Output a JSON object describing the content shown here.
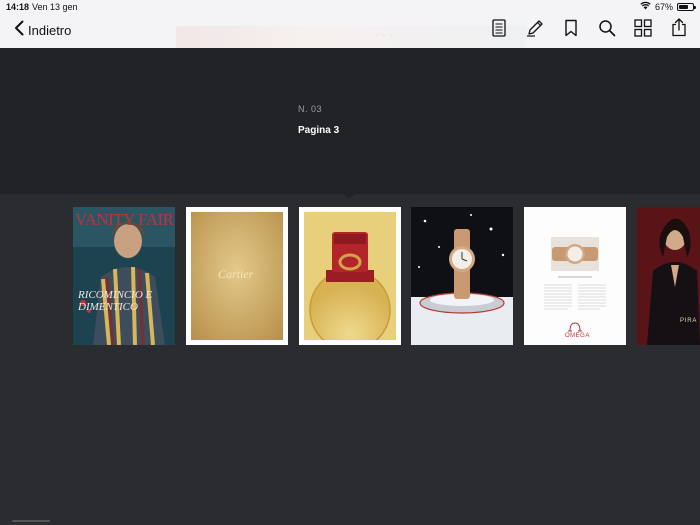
{
  "status": {
    "time": "14:18",
    "date": "Ven 13 gen",
    "battery_percent": "67%",
    "battery_level": 0.67
  },
  "nav": {
    "back_label": "Indietro",
    "tools": [
      {
        "icon": "contents-icon"
      },
      {
        "icon": "pencil-icon"
      },
      {
        "icon": "bookmark-icon"
      },
      {
        "icon": "search-icon"
      },
      {
        "icon": "thumbnails-icon"
      },
      {
        "icon": "share-icon"
      }
    ]
  },
  "info": {
    "issue": "N. 03",
    "page": "Pagina 3"
  },
  "thumbs": [
    {
      "cover_title": "VANITY FAIR",
      "headline": "RICOMINCIO E DIMENTICO"
    },
    {
      "brand": "Cartier"
    },
    {
      "brand": ""
    },
    {
      "brand": ""
    },
    {
      "brand": "OMEGA"
    },
    {
      "brand": "PIRA"
    }
  ],
  "colors": {
    "background": "#2b2c30",
    "info_panel": "#222327",
    "bar": "#f4f4f6"
  }
}
